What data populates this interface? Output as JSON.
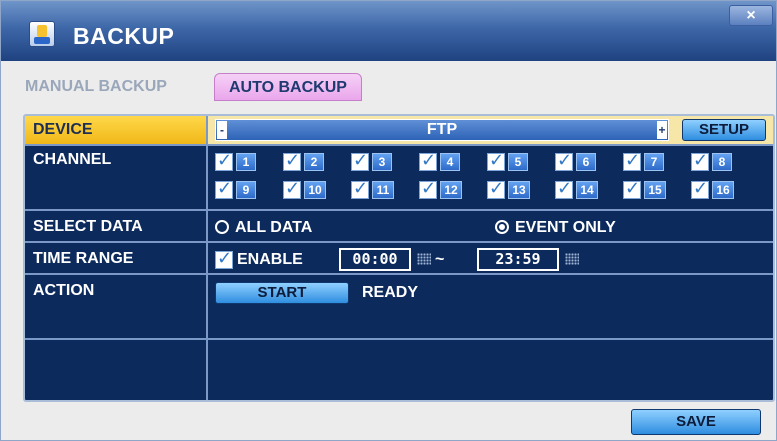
{
  "window": {
    "title": "BACKUP",
    "title_icon": "backup-disk-icon",
    "close_label": "×"
  },
  "tabs": [
    {
      "label": "MANUAL BACKUP",
      "active": false
    },
    {
      "label": "AUTO BACKUP",
      "active": true
    }
  ],
  "device": {
    "label": "DEVICE",
    "value": "FTP",
    "minus": "-",
    "plus": "+",
    "setup_label": "SETUP"
  },
  "channel": {
    "label": "CHANNEL",
    "items": [
      "1",
      "2",
      "3",
      "4",
      "5",
      "6",
      "7",
      "8",
      "9",
      "10",
      "11",
      "12",
      "13",
      "14",
      "15",
      "16"
    ],
    "all_checked": true
  },
  "select_data": {
    "label": "SELECT DATA",
    "options": [
      "ALL DATA",
      "EVENT ONLY"
    ],
    "selected": "EVENT ONLY"
  },
  "time_range": {
    "label": "TIME RANGE",
    "enable_label": "ENABLE",
    "enabled": true,
    "start": "00:00",
    "separator": "~",
    "end": "23:59"
  },
  "action": {
    "label": "ACTION",
    "start_label": "START",
    "status": "READY"
  },
  "footer": {
    "save_label": "SAVE"
  },
  "colors": {
    "panel_bg": "#0c2b5c",
    "titlebar": "#2f55a0",
    "highlight": "#f0b818",
    "active_tab": "#eaa6ec"
  }
}
